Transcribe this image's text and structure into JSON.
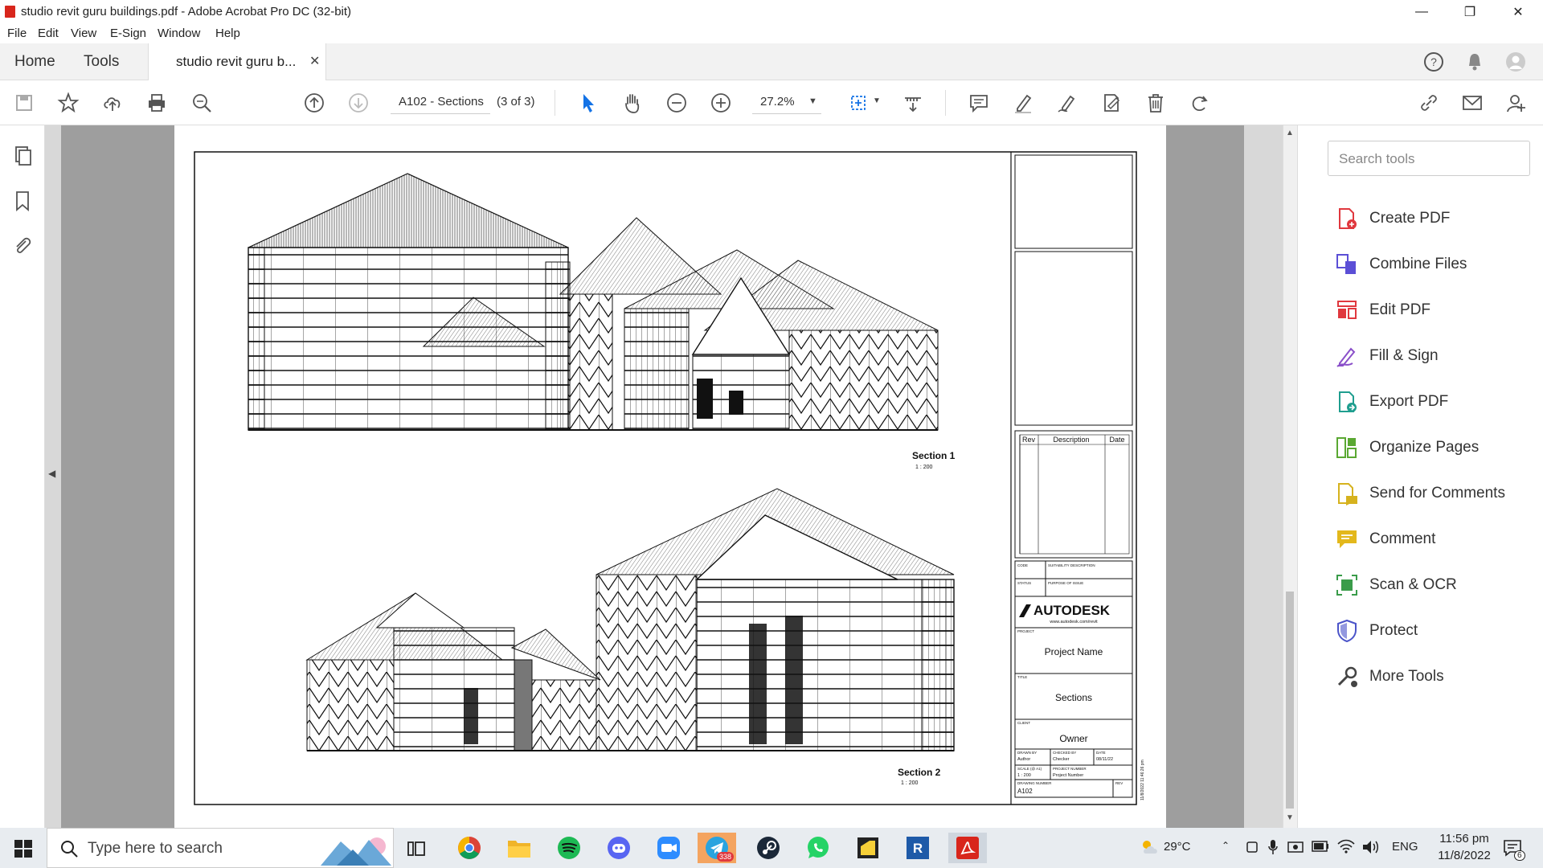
{
  "window": {
    "title": "studio revit guru buildings.pdf - Adobe Acrobat Pro DC (32-bit)"
  },
  "menu": [
    "File",
    "Edit",
    "View",
    "E-Sign",
    "Window",
    "Help"
  ],
  "tabs": {
    "home": "Home",
    "tools": "Tools",
    "document": "studio revit guru b..."
  },
  "toolbar": {
    "page_label": "A102 - Sections",
    "page_count": "(3 of 3)",
    "zoom": "27.2%"
  },
  "drawing": {
    "section1_title": "Section 1",
    "section1_scale": "1 : 200",
    "section2_title": "Section 2",
    "section2_scale": "1 : 200",
    "rev_headers": [
      "Rev",
      "Description",
      "Date"
    ],
    "code_label": "CODE",
    "suitability_label": "SUITABILITY DESCRIPTION",
    "status_label": "STATUS",
    "purpose_label": "PURPOSE OF ISSUE",
    "brand": "AUTODESK",
    "brand_url": "www.autodesk.com/revit",
    "project_label": "PROJECT",
    "project_name": "Project Name",
    "title_label": "TITLE",
    "sheet_title": "Sections",
    "client_label": "CLIENT",
    "client": "Owner",
    "drawn_by_label": "DRAWN BY",
    "drawn_by": "Author",
    "checked_by_label": "CHECKED BY",
    "checked_by": "Checker",
    "date_label": "DATE",
    "date": "08/11/22",
    "scale_label": "SCALE (@ A1)",
    "scale": "1 : 200",
    "project_number_label": "PROJECT NUMBER",
    "project_number": "Project Number",
    "drawing_number_label": "DRAWING NUMBER",
    "drawing_number": "A102",
    "rev_label": "REV",
    "timestamp": "11/8/2022 11:46:26 pm"
  },
  "tools_panel": {
    "search_placeholder": "Search tools",
    "items": [
      {
        "label": "Create PDF",
        "color": "#e0383e"
      },
      {
        "label": "Combine Files",
        "color": "#5b4fd6"
      },
      {
        "label": "Edit PDF",
        "color": "#e0383e"
      },
      {
        "label": "Fill & Sign",
        "color": "#8a4fc9"
      },
      {
        "label": "Export PDF",
        "color": "#1f9e8f"
      },
      {
        "label": "Organize Pages",
        "color": "#5aa832"
      },
      {
        "label": "Send for Comments",
        "color": "#d6b21e"
      },
      {
        "label": "Comment",
        "color": "#e3b81c"
      },
      {
        "label": "Scan & OCR",
        "color": "#3a9c4a"
      },
      {
        "label": "Protect",
        "color": "#4b54c9"
      },
      {
        "label": "More Tools",
        "color": "#444444"
      }
    ]
  },
  "taskbar": {
    "search_placeholder": "Type here to search",
    "weather": "29°C",
    "language": "ENG",
    "time": "11:56 pm",
    "date": "11/8/2022",
    "telegram_badge": "338",
    "notification_count": "6"
  }
}
